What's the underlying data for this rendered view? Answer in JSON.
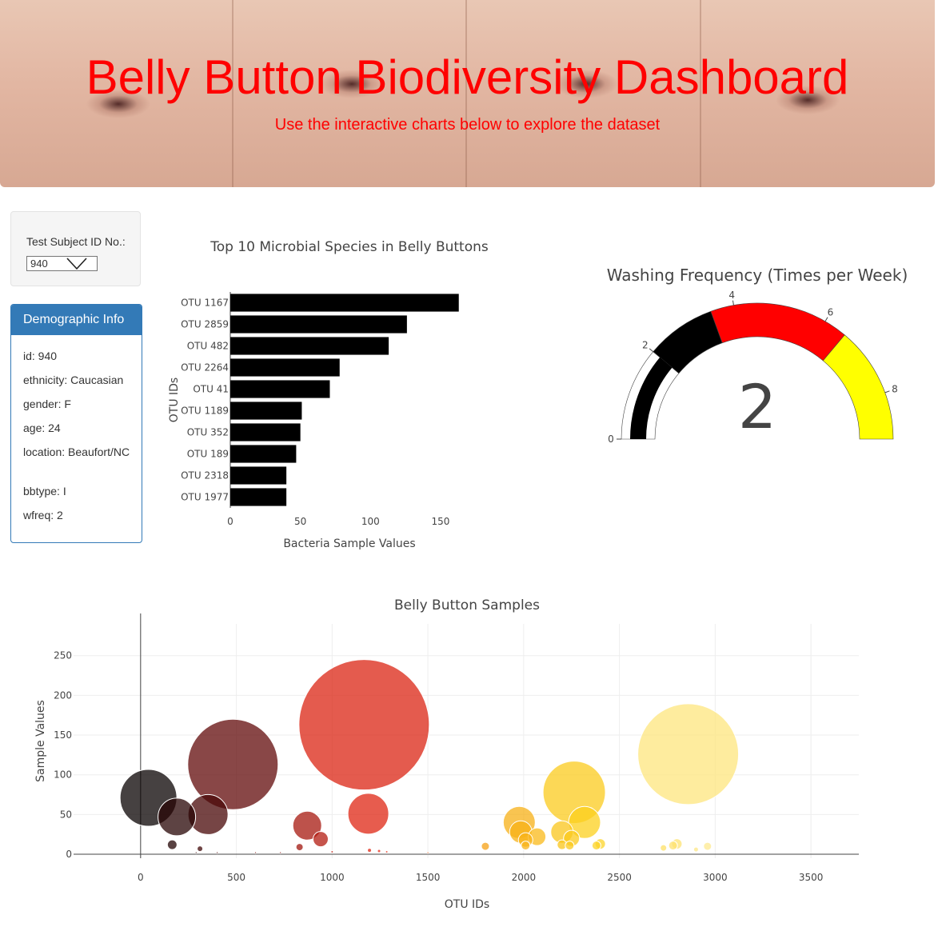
{
  "header": {
    "title": "Belly Button Biodiversity Dashboard",
    "subtitle": "Use the interactive charts below to explore the dataset"
  },
  "selector": {
    "label": "Test Subject ID No.:",
    "selected": "940"
  },
  "demographics": {
    "heading": "Demographic Info",
    "items": [
      "id: 940",
      "ethnicity: Caucasian",
      "gender: F",
      "age: 24",
      "location: Beaufort/NC",
      "bbtype: I",
      "wfreq: 2"
    ]
  },
  "colors": {
    "header_text": "#ff0000",
    "panel_primary": "#337ab7",
    "bar_fill": "#000000"
  },
  "chart_data": [
    {
      "type": "bar",
      "orientation": "horizontal",
      "title": "Top 10 Microbial Species in Belly Buttons",
      "xlabel": "Bacteria Sample Values",
      "ylabel": "OTU IDs",
      "categories": [
        "OTU 1167",
        "OTU 2859",
        "OTU 482",
        "OTU 2264",
        "OTU 41",
        "OTU 1189",
        "OTU 352",
        "OTU 189",
        "OTU 2318",
        "OTU 1977"
      ],
      "values": [
        163,
        126,
        113,
        78,
        71,
        51,
        50,
        47,
        40,
        40
      ],
      "xlim": [
        0,
        170
      ],
      "xticks": [
        0,
        50,
        100,
        150
      ],
      "grid": false
    },
    {
      "type": "gauge",
      "title": "Washing Frequency (Times per Week)",
      "value": 2,
      "range": [
        0,
        9
      ],
      "ticks": [
        0,
        2,
        4,
        6,
        8
      ],
      "steps": [
        {
          "range": [
            0,
            2
          ],
          "color": "#ffffff"
        },
        {
          "range": [
            2,
            3.5
          ],
          "color": "#000000"
        },
        {
          "range": [
            3.5,
            6.5
          ],
          "color": "#ff0000"
        },
        {
          "range": [
            6.5,
            9
          ],
          "color": "#ffff00"
        }
      ],
      "bar_color": "#000000"
    },
    {
      "type": "scatter",
      "title": "Belly Button Samples",
      "xlabel": "OTU IDs",
      "ylabel": "Sample Values",
      "xlim": [
        -350,
        3750
      ],
      "ylim": [
        -5,
        290
      ],
      "xticks": [
        0,
        500,
        1000,
        1500,
        2000,
        2500,
        3000,
        3500
      ],
      "yticks": [
        0,
        50,
        100,
        150,
        200,
        250
      ],
      "grid": true,
      "marker_size": "sample value",
      "marker_color": "OTU ID",
      "points": [
        {
          "x": 41,
          "y": 71
        },
        {
          "x": 189,
          "y": 47
        },
        {
          "x": 352,
          "y": 50
        },
        {
          "x": 482,
          "y": 113
        },
        {
          "x": 165,
          "y": 12
        },
        {
          "x": 310,
          "y": 7
        },
        {
          "x": 870,
          "y": 36
        },
        {
          "x": 940,
          "y": 19
        },
        {
          "x": 830,
          "y": 9
        },
        {
          "x": 1167,
          "y": 163
        },
        {
          "x": 1189,
          "y": 51
        },
        {
          "x": 1195,
          "y": 5
        },
        {
          "x": 1245,
          "y": 4
        },
        {
          "x": 1285,
          "y": 3
        },
        {
          "x": 1800,
          "y": 10
        },
        {
          "x": 1977,
          "y": 40
        },
        {
          "x": 1985,
          "y": 28
        },
        {
          "x": 2010,
          "y": 18
        },
        {
          "x": 2070,
          "y": 22
        },
        {
          "x": 2010,
          "y": 11
        },
        {
          "x": 2264,
          "y": 78
        },
        {
          "x": 2318,
          "y": 40
        },
        {
          "x": 2200,
          "y": 28
        },
        {
          "x": 2250,
          "y": 20
        },
        {
          "x": 2200,
          "y": 12
        },
        {
          "x": 2240,
          "y": 11
        },
        {
          "x": 2400,
          "y": 13
        },
        {
          "x": 2380,
          "y": 11
        },
        {
          "x": 2730,
          "y": 8
        },
        {
          "x": 2800,
          "y": 13
        },
        {
          "x": 2780,
          "y": 11
        },
        {
          "x": 2859,
          "y": 126
        },
        {
          "x": 2960,
          "y": 10
        },
        {
          "x": 2900,
          "y": 6
        },
        {
          "x": 1000,
          "y": 3
        },
        {
          "x": 1500,
          "y": 2
        },
        {
          "x": 730,
          "y": 2
        },
        {
          "x": 600,
          "y": 2
        },
        {
          "x": 400,
          "y": 2
        },
        {
          "x": 290,
          "y": 2
        }
      ]
    }
  ]
}
